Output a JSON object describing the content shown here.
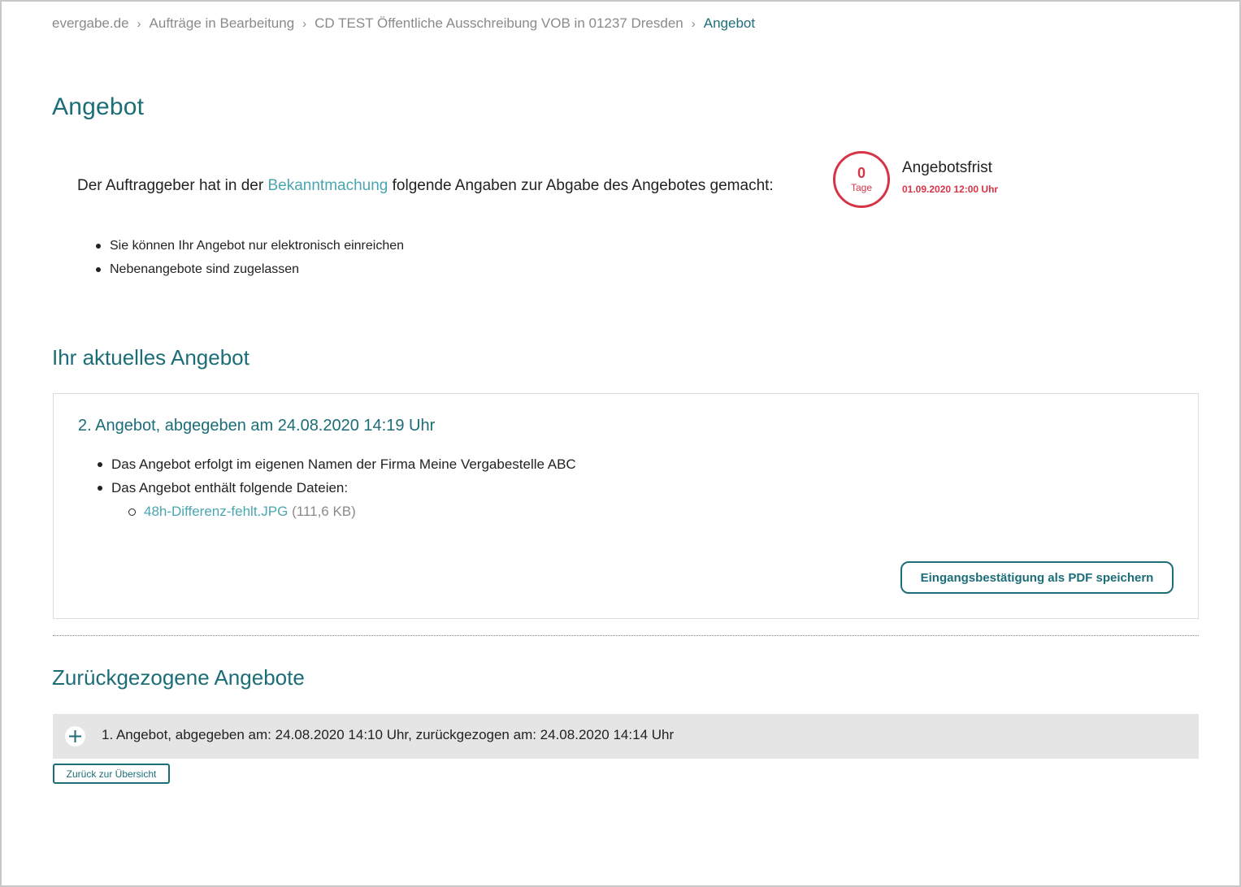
{
  "breadcrumb": {
    "items": [
      "evergabe.de",
      "Aufträge in Bearbeitung",
      "CD TEST Öffentliche Ausschreibung VOB in 01237 Dresden",
      "Angebot"
    ]
  },
  "page": {
    "title": "Angebot"
  },
  "intro": {
    "text_before": "Der Auftraggeber hat in der ",
    "link": "Bekanntmachung",
    "text_after": " folgende Angaben zur Abgabe des Angebotes gemacht:",
    "items": [
      "Sie können Ihr Angebot nur elektronisch einreichen",
      "Nebenangebote sind zugelassen"
    ]
  },
  "deadline": {
    "days": "0",
    "days_label": "Tage",
    "title": "Angebotsfrist",
    "date": "01.09.2020 12:00 Uhr",
    "color": "#d63447"
  },
  "current_offer": {
    "section_title": "Ihr aktuelles Angebot",
    "heading": "2. Angebot, abgegeben am 24.08.2020 14:19 Uhr",
    "items": [
      "Das Angebot erfolgt im eigenen Namen der Firma Meine Vergabestelle ABC",
      "Das Angebot enthält folgende Dateien:"
    ],
    "file": {
      "name": "48h-Differenz-fehlt.JPG",
      "size": "(111,6 KB)"
    },
    "pdf_button": "Eingangsbestätigung als PDF speichern"
  },
  "withdrawn": {
    "section_title": "Zurückgezogene Angebote",
    "rows": [
      "1. Angebot, abgegeben am: 24.08.2020 14:10 Uhr, zurückgezogen am: 24.08.2020 14:14 Uhr"
    ]
  },
  "back_button": "Zurück zur Übersicht",
  "colors": {
    "accent": "#1b6e78",
    "link": "#4aa6b0",
    "alert": "#d63447"
  }
}
